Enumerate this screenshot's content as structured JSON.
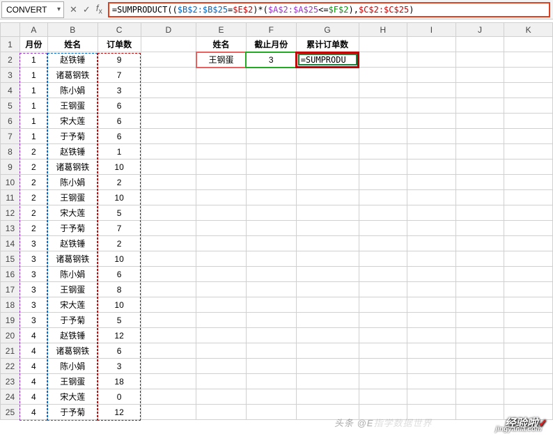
{
  "namebox": "CONVERT",
  "formula": {
    "full": "=SUMPRODUCT(($B$2:$B$25=$E$2)*($A$2:$A$25<=$F$2),$C$2:$C$25)",
    "parts": [
      {
        "t": "=SUMPRODUCT(",
        "c": "p-black"
      },
      {
        "t": "(",
        "c": "p-black"
      },
      {
        "t": "$B$2:$B$25",
        "c": "p-blue"
      },
      {
        "t": "=",
        "c": "p-black"
      },
      {
        "t": "$E$2",
        "c": "p-red"
      },
      {
        "t": ")*(",
        "c": "p-black"
      },
      {
        "t": "$A$2:$A$25",
        "c": "p-purple"
      },
      {
        "t": "<=",
        "c": "p-black"
      },
      {
        "t": "$F$2",
        "c": "p-green"
      },
      {
        "t": "),",
        "c": "p-black"
      },
      {
        "t": "$C$2:$C$25",
        "c": "p-red"
      },
      {
        "t": ")",
        "c": "p-black"
      }
    ]
  },
  "columns": [
    "A",
    "B",
    "C",
    "D",
    "E",
    "F",
    "G",
    "H",
    "I",
    "J",
    "K"
  ],
  "headers": {
    "A": "月份",
    "B": "姓名",
    "C": "订单数",
    "E": "姓名",
    "F": "截止月份",
    "G": "累计订单数"
  },
  "row2": {
    "E": "王钢蛋",
    "F": "3",
    "G": "=SUMPRODU"
  },
  "data": [
    {
      "m": "1",
      "n": "赵铁锤",
      "v": "9"
    },
    {
      "m": "1",
      "n": "诸葛钢铁",
      "v": "7"
    },
    {
      "m": "1",
      "n": "陈小娟",
      "v": "3"
    },
    {
      "m": "1",
      "n": "王钢蛋",
      "v": "6"
    },
    {
      "m": "1",
      "n": "宋大莲",
      "v": "6"
    },
    {
      "m": "1",
      "n": "于予菊",
      "v": "6"
    },
    {
      "m": "2",
      "n": "赵铁锤",
      "v": "1"
    },
    {
      "m": "2",
      "n": "诸葛钢铁",
      "v": "10"
    },
    {
      "m": "2",
      "n": "陈小娟",
      "v": "2"
    },
    {
      "m": "2",
      "n": "王钢蛋",
      "v": "10"
    },
    {
      "m": "2",
      "n": "宋大莲",
      "v": "5"
    },
    {
      "m": "2",
      "n": "于予菊",
      "v": "7"
    },
    {
      "m": "3",
      "n": "赵铁锤",
      "v": "2"
    },
    {
      "m": "3",
      "n": "诸葛钢铁",
      "v": "10"
    },
    {
      "m": "3",
      "n": "陈小娟",
      "v": "6"
    },
    {
      "m": "3",
      "n": "王钢蛋",
      "v": "8"
    },
    {
      "m": "3",
      "n": "宋大莲",
      "v": "10"
    },
    {
      "m": "3",
      "n": "于予菊",
      "v": "5"
    },
    {
      "m": "4",
      "n": "赵铁锤",
      "v": "12"
    },
    {
      "m": "4",
      "n": "诸葛钢铁",
      "v": "6"
    },
    {
      "m": "4",
      "n": "陈小娟",
      "v": "3"
    },
    {
      "m": "4",
      "n": "王钢蛋",
      "v": "18"
    },
    {
      "m": "4",
      "n": "宋大莲",
      "v": "0"
    },
    {
      "m": "4",
      "n": "于予菊",
      "v": "12"
    }
  ],
  "watermark": "经验啦",
  "watermark_sub": "jingyanla.com",
  "toutiao": "头条 @E"
}
